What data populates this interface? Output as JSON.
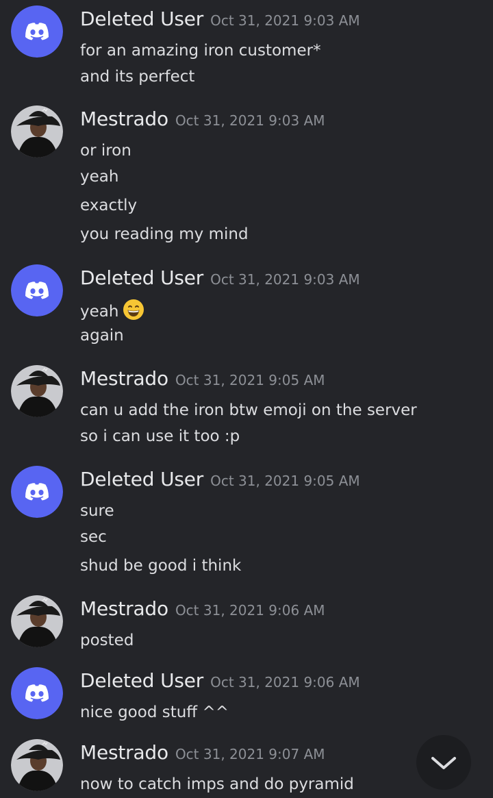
{
  "messages": [
    {
      "author": "Deleted User",
      "timestamp": "Oct 31, 2021 9:03 AM",
      "avatar": "discord-logo-icon",
      "lines": [
        "for an amazing iron customer*",
        "and its perfect"
      ]
    },
    {
      "author": "Mestrado",
      "timestamp": "Oct 31, 2021 9:03 AM",
      "avatar": "user-photo",
      "lines": [
        "or iron",
        "yeah",
        "exactly",
        "you reading my mind"
      ]
    },
    {
      "author": "Deleted User",
      "timestamp": "Oct 31, 2021 9:03 AM",
      "avatar": "discord-logo-icon",
      "lines": [
        "yeah",
        "again"
      ],
      "emoji": "grinning-face-emoji"
    },
    {
      "author": "Mestrado",
      "timestamp": "Oct 31, 2021 9:05 AM",
      "avatar": "user-photo",
      "lines": [
        "can u add the iron btw emoji on the server",
        "so i can use it too :p"
      ]
    },
    {
      "author": "Deleted User",
      "timestamp": "Oct 31, 2021 9:05 AM",
      "avatar": "discord-logo-icon",
      "lines": [
        "sure",
        "sec",
        "shud be good i think"
      ]
    },
    {
      "author": "Mestrado",
      "timestamp": "Oct 31, 2021 9:06 AM",
      "avatar": "user-photo",
      "lines": [
        "posted"
      ]
    },
    {
      "author": "Deleted User",
      "timestamp": "Oct 31, 2021 9:06 AM",
      "avatar": "discord-logo-icon",
      "lines": [
        "nice good stuff ^^"
      ]
    },
    {
      "author": "Mestrado",
      "timestamp": "Oct 31, 2021 9:07 AM",
      "avatar": "user-photo",
      "lines": [
        "now to catch imps and do pyramid"
      ]
    }
  ],
  "scroll_button": {
    "icon": "chevron-down-icon"
  },
  "colors": {
    "background": "#242529",
    "discord_blurple": "#5865f2",
    "author": "#e8e9eb",
    "timestamp": "#8d9096",
    "text": "#dcdde0"
  }
}
